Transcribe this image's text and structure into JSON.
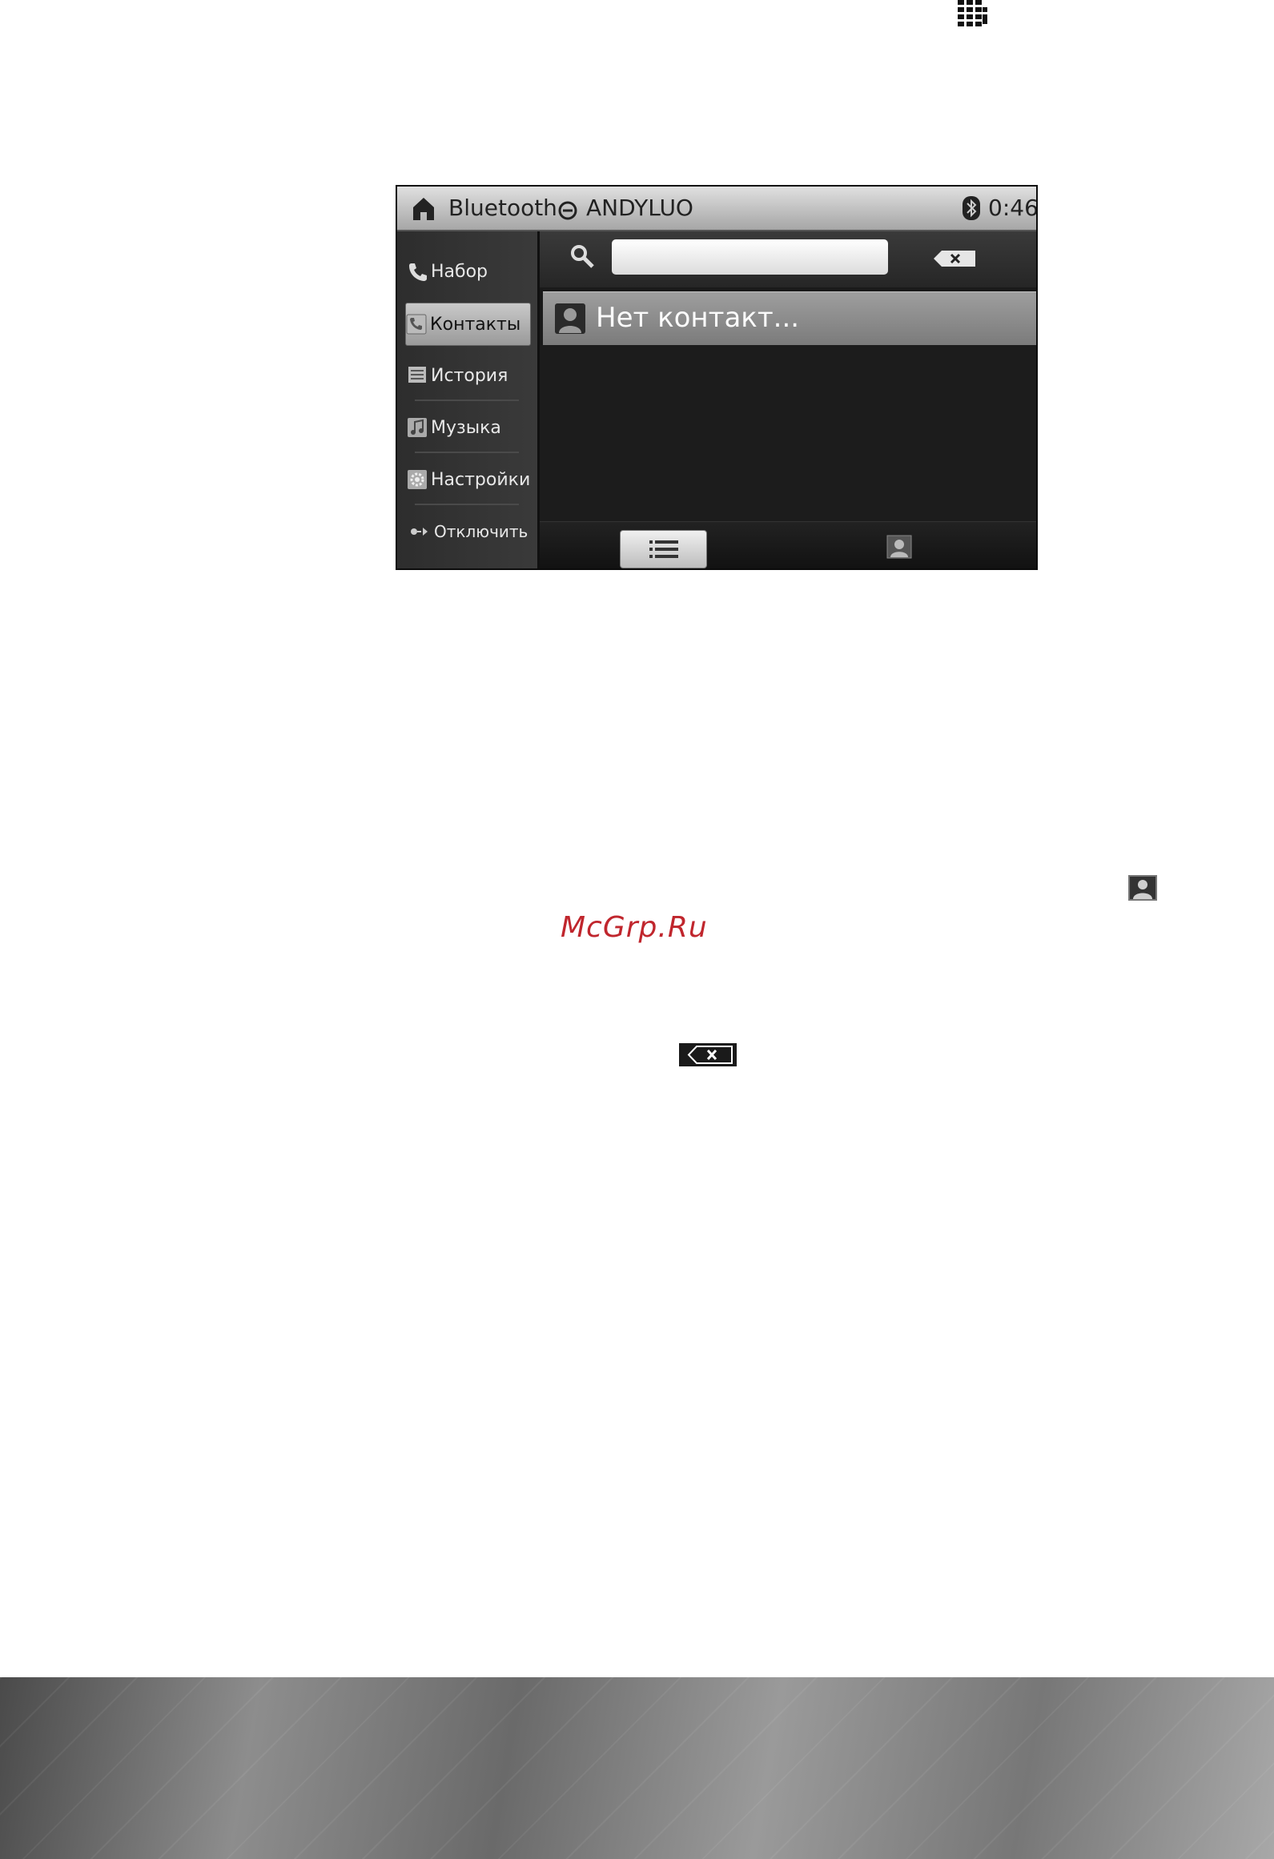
{
  "device": {
    "status": {
      "title": "Bluetooth",
      "device_name": "ANDYLUO",
      "time": "0:46"
    },
    "sidebar": {
      "items": [
        {
          "label": "Набор",
          "icon": "phone-icon"
        },
        {
          "label": "Контакты",
          "icon": "contacts-phone-icon",
          "active": true
        },
        {
          "label": "История",
          "icon": "history-icon"
        },
        {
          "label": "Музыка",
          "icon": "music-icon"
        },
        {
          "label": "Настройки",
          "icon": "settings-icon"
        },
        {
          "label": "Отключить",
          "icon": "disconnect-icon"
        }
      ]
    },
    "search": {
      "value": "",
      "placeholder": ""
    },
    "contacts": {
      "empty_label": "Нет контакт..."
    }
  },
  "watermark": "McGrp.Ru"
}
